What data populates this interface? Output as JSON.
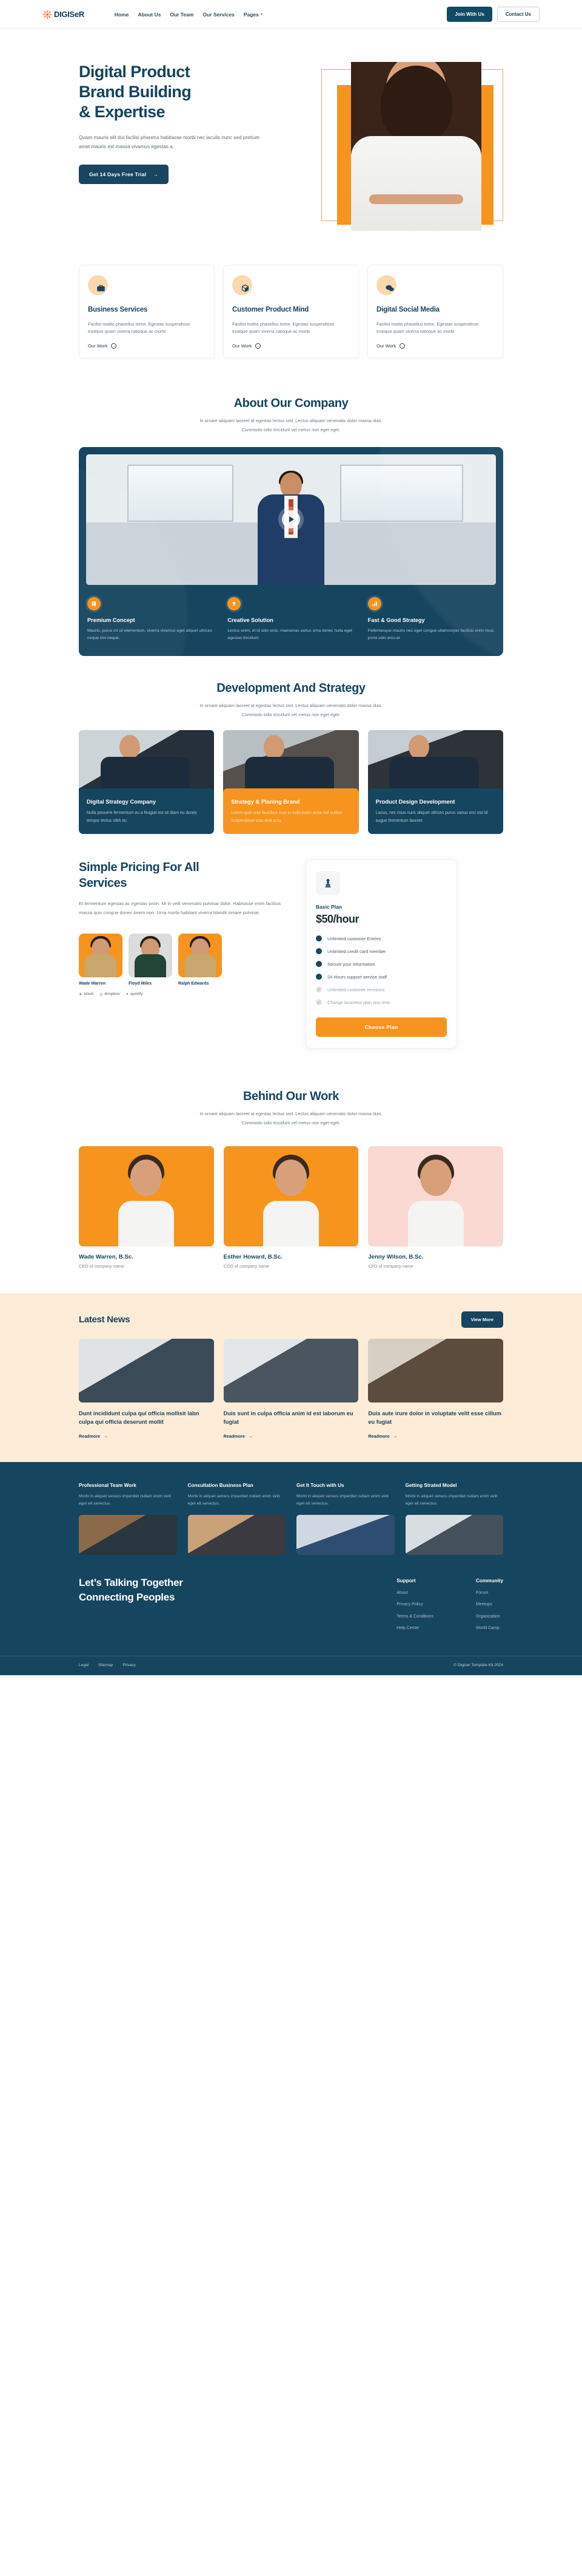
{
  "header": {
    "brand": "DIGISeR",
    "nav": [
      {
        "label": "Home",
        "caret": false
      },
      {
        "label": "About Us",
        "caret": false
      },
      {
        "label": "Our Team",
        "caret": false
      },
      {
        "label": "Our Services",
        "caret": false
      },
      {
        "label": "Pages",
        "caret": true
      }
    ],
    "join_label": "Join With Us",
    "contact_label": "Contact Us"
  },
  "hero": {
    "title_line1": "Digital Product",
    "title_line2": "Brand Building",
    "title_line3": "& Expertise",
    "paragraph": "Quam mauris elit dui facilisi pharetra habitasse morbi nec  iaculis nunc sed pretium amet mauris est massa vivamus egestas a.",
    "cta_label": "Get 14 Days Free Trial",
    "cta_arrow": "→"
  },
  "services": [
    {
      "icon": "briefcase-icon",
      "glyph": "💼",
      "title": "Business Services",
      "desc": "Facilisi mattis phasellus tortor. Egestas suspendisse tristique quam viverra natoque ac morbi",
      "link": "Our Work"
    },
    {
      "icon": "cube-icon",
      "glyph": "⬟",
      "title": "Customer Product Mind",
      "desc": "Facilisi mattis phasellus tortor. Egestas suspendisse tristique quam viverra natoque ac morbi",
      "link": "Our Work"
    },
    {
      "icon": "chat-bubbles-icon",
      "glyph": "💬",
      "title": "Digital Social Media",
      "desc": "Facilisi mattis phasellus tortor. Egestas suspendisse tristique quam viverra natoque ac morbi",
      "link": "Our Work"
    }
  ],
  "about": {
    "title": "About Our Company",
    "sub_line1": "In ornare aliquam laoreet at egestas lectus sed. Lectus aliquam venenatis dolor massa duis.",
    "sub_line2": "Commodo odio tincidunt vel metus non eget eget.",
    "features": [
      {
        "icon": "book-icon",
        "glyph": "📘",
        "title": "Premium Concept",
        "desc": "Mauris, purus mi sit elementum, viverra vivamus eget aliquet ultrices neque nisl neque."
      },
      {
        "icon": "idea-icon",
        "glyph": "✨",
        "title": "Creative Solution",
        "desc": "Lectus enim, et id odio eros, maecenas varius urna donec nulla eget egestas tincidunt"
      },
      {
        "icon": "chart-icon",
        "glyph": "📈",
        "title": "Fast & Good Strategy",
        "desc": "Pellentesque mauris nec eget congue ullamcorper facilisis enim risus porta odio arcu et"
      }
    ]
  },
  "strategy": {
    "title": "Development And Strategy",
    "sub_line1": "In ornare aliquam laoreet at egestas lectus sed. Lectus aliquam venenatis dolor massa duis.",
    "sub_line2": "Commodo odio tincidunt vel metus non eget eget.",
    "cards": [
      {
        "title": "Digital Strategy Company",
        "desc": "Nulla posuere fermentum eu a feugiat est sit diam eu donec tempor lectus nibh eu",
        "accent": false
      },
      {
        "title": "Strategy & Planing Brand",
        "desc": "Lorem quis cras faucibus cras in sollicitudin assa nisl nullam suspendisse cras erat arcu",
        "accent": true
      },
      {
        "title": "Product Design Development",
        "desc": "Lacus, nec risus nunc aliquet ultrices purus varius orci nisl id augue fermentum laoreet",
        "accent": false
      }
    ]
  },
  "pricing": {
    "heading_line1": "Simple Pricing For All",
    "heading_line2": "Services",
    "paragraph": "Et fermentum egestas ac egestas proin. Mi in velit venenatis pulvinar dolor. Habitasse enim facilisis massa quis congue donec lorem non. Urna morbi habitant viverra blandit ornare pulvinar.",
    "team": [
      {
        "name": "Wade Warren",
        "tone": "orange"
      },
      {
        "name": "Floyd Miles",
        "tone": "grey"
      },
      {
        "name": "Ralph Edwards",
        "tone": "orange"
      }
    ],
    "logos": [
      "slack",
      "dropbox",
      "spotify"
    ],
    "plan": {
      "icon": "chess-pawn-icon",
      "glyph": "♟",
      "name": "Basic Plan",
      "price": "$50/hour",
      "features": [
        {
          "label": "Unlimited customer Entries",
          "on": true
        },
        {
          "label": "Unlimited credit card member",
          "on": true
        },
        {
          "label": "Secure your information",
          "on": true
        },
        {
          "label": "24 Hours support service staff",
          "on": true
        },
        {
          "label": "Unlimited customer revisions",
          "on": false
        },
        {
          "label": "Change business plan any time",
          "on": false
        }
      ],
      "button": "Choose Plan"
    }
  },
  "behind": {
    "title": "Behind Our Work",
    "sub_line1": "In ornare aliquam laoreet at egestas lectus sed. Lectus aliquam venenatis dolor massa duis.",
    "sub_line2": "Commodo odio tincidunt vel metus non eget eget.",
    "members": [
      {
        "name": "Wade Warren, B.Sc.",
        "role": "CEO of company name",
        "tone": "orange"
      },
      {
        "name": "Esther Howard, B.Sc.",
        "role": "COO of company name",
        "tone": "orange"
      },
      {
        "name": "Jenny Wilson, B.Sc.",
        "role": "CFO of company name",
        "tone": "pink"
      }
    ]
  },
  "news": {
    "title": "Latest News",
    "view_more": "View More",
    "posts": [
      {
        "title": "Dunt incididunt culpa qui officia mollisit labn culpa qui officia deserunt mollit",
        "more": "Readmore"
      },
      {
        "title": "Duis sunt in culpa officia anim id est laborum eu fugiat",
        "more": "Readmore"
      },
      {
        "title": "Duis aute irure dolor in voluptate velit esse cillum eu fugiat",
        "more": "Readmore"
      }
    ]
  },
  "footer": {
    "columns": [
      {
        "title": "Professional Team Work",
        "desc": "Morbi in aliquet senecs imperdiet nullam enim velit eget elt senectus."
      },
      {
        "title": "Consultation Business Plan",
        "desc": "Morbi in aliquet senecs imperdiet nullam enim velit eget elt senectus."
      },
      {
        "title": "Get It Touch with Us",
        "desc": "Morbi in aliquet senecs imperdiet nullam enim velit eget elt senectus."
      },
      {
        "title": "Getting Strated Model",
        "desc": "Morbi in aliquet senecs imperdiet nullam enim velit eget elt senectus."
      }
    ],
    "brand_line1": "Let’s Talking Together",
    "brand_line2": "Connecting Peoples",
    "link_groups": [
      {
        "title": "Support",
        "links": [
          "About",
          "Privacy Policy",
          "Terms & Conditions",
          "Help Center"
        ]
      },
      {
        "title": "Community",
        "links": [
          "Forum",
          "Meetups",
          "Organization",
          "World Camp"
        ]
      }
    ],
    "bottom_links": [
      "Legal",
      "Sitemap",
      "Privacy"
    ],
    "copyright": "© Digiser Template Kit 2024"
  },
  "colors": {
    "navy": "#16455F",
    "orange": "#F7941E",
    "cream": "#FDECD8"
  }
}
